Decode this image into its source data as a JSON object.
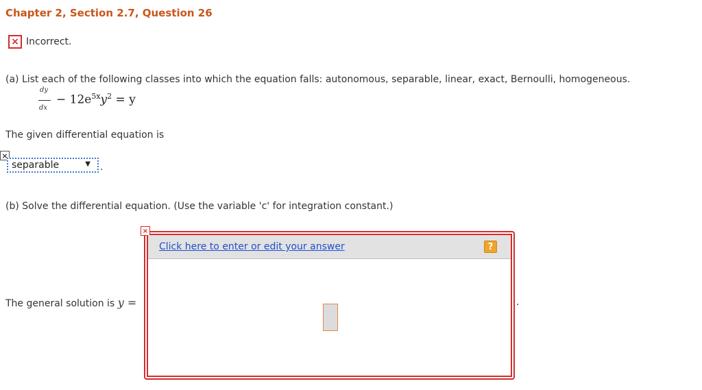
{
  "header": {
    "title": "Chapter 2, Section 2.7, Question 26"
  },
  "status": {
    "icon": "x-mark-icon",
    "glyph": "×",
    "text": "Incorrect."
  },
  "part_a": {
    "prompt": "(a) List each of the following classes into which the equation falls: autonomous, separable, linear, exact, Bernoulli, homogeneous.",
    "equation": {
      "numerator": "dy",
      "denominator": "dx",
      "rest": "− 12e",
      "exp": "5x",
      "y": "y",
      "sq": "2",
      "rhs": " = y"
    },
    "given_label": "The given differential equation is",
    "select_value": "separable",
    "select_arrow": "▼",
    "mark_glyph": "×",
    "end_punct": "."
  },
  "part_b": {
    "prompt": "(b) Solve the differential equation. (Use the variable 'c' for integration constant.)",
    "answer_link": "Click here to enter or edit your answer",
    "help_glyph": "?",
    "solution_prefix": "The general solution is ",
    "solution_var": "y =",
    "end_punct": ".",
    "mark_glyph": "×"
  },
  "colors": {
    "title": "#c9561a",
    "error": "#d42b2b",
    "link": "#1f4fcf",
    "help": "#f0a42a"
  }
}
